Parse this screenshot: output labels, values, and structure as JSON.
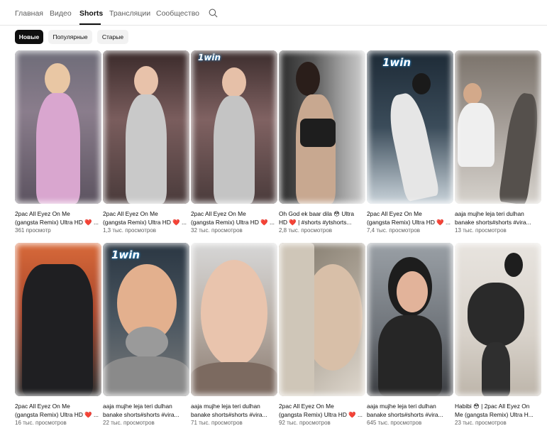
{
  "nav": {
    "tabs": [
      {
        "label": "Главная"
      },
      {
        "label": "Видео"
      },
      {
        "label": "Shorts"
      },
      {
        "label": "Трансляции"
      },
      {
        "label": "Сообщество"
      }
    ],
    "active_tab": "Shorts"
  },
  "filters": {
    "chips": [
      {
        "label": "Новые",
        "selected": true
      },
      {
        "label": "Популярные",
        "selected": false
      },
      {
        "label": "Старые",
        "selected": false
      }
    ]
  },
  "shorts": [
    {
      "title_line1": "2pac All Eyez On Me",
      "title_line2": "(gangsta Remix) Ultra HD ❤️ ...",
      "views": "361 просмотр",
      "logo": ""
    },
    {
      "title_line1": "2pac All Eyez On Me",
      "title_line2": "(gangsta Remix) Ultra HD ❤️ ...",
      "views": "1,3 тыс. просмотров",
      "logo": ""
    },
    {
      "title_line1": "2pac All Eyez On Me",
      "title_line2": "(gangsta Remix) Ultra HD ❤️ ...",
      "views": "32 тыс. просмотров",
      "logo": "1win"
    },
    {
      "title_line1": "Oh God ek baar dila 😳 Ultra",
      "title_line2": "HD ❤️ | #shorts #ytshorts...",
      "views": "2,8 тыс. просмотров",
      "logo": ""
    },
    {
      "title_line1": "2pac All Eyez On Me",
      "title_line2": "(gangsta Remix) Ultra HD ❤️ ...",
      "views": "7,4 тыс. просмотров",
      "logo": "1win"
    },
    {
      "title_line1": "aaja mujhe leja teri dulhan",
      "title_line2": "banake shorts#shorts #vira...",
      "views": "13 тыс. просмотров",
      "logo": ""
    },
    {
      "title_line1": "2pac All Eyez On Me",
      "title_line2": "(gangsta Remix) Ultra HD ❤️ ...",
      "views": "16 тыс. просмотров",
      "logo": ""
    },
    {
      "title_line1": "aaja mujhe leja teri dulhan",
      "title_line2": "banake shorts#shorts #vira...",
      "views": "22 тыс. просмотров",
      "logo": "1win"
    },
    {
      "title_line1": "aaja mujhe leja teri dulhan",
      "title_line2": "banake shorts#shorts #vira...",
      "views": "71 тыс. просмотров",
      "logo": ""
    },
    {
      "title_line1": "2pac All Eyez On Me",
      "title_line2": "(gangsta Remix) Ultra HD ❤️ ...",
      "views": "92 тыс. просмотров",
      "logo": ""
    },
    {
      "title_line1": "aaja mujhe leja teri dulhan",
      "title_line2": "banake shorts#shorts #vira...",
      "views": "645 тыс. просмотров",
      "logo": ""
    },
    {
      "title_line1": "Habibi 😳 | 2pac All Eyez On",
      "title_line2": "Me (gangsta Remix) Ultra H...",
      "views": "23 тыс. просмотров",
      "logo": ""
    }
  ],
  "colors": {
    "text_primary": "#0f0f0f",
    "text_secondary": "#606060",
    "chip_bg": "#f2f2f2",
    "chip_selected_bg": "#0f0f0f"
  }
}
